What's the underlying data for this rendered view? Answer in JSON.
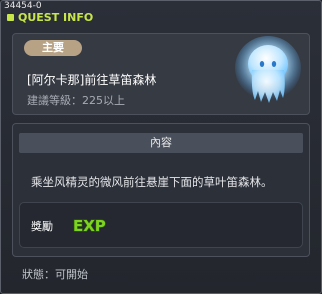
{
  "window": {
    "quest_id": "34454-0",
    "title": "QUEST INFO"
  },
  "summary": {
    "badge": "主要",
    "quest_name": "[阿尔卡那]前往草笛森林",
    "level_requirement": "建議等級：225以上",
    "npc_icon": "blue-ghost-spirit-icon"
  },
  "content": {
    "heading": "內容",
    "description": "乘坐风精灵的微风前往悬崖下面的草叶笛森林。"
  },
  "reward": {
    "label": "獎勵",
    "exp_icon": "exp-icon",
    "exp_text": "EXP"
  },
  "status": {
    "text": "狀態：可開始"
  },
  "colors": {
    "title_accent": "#c8e64a",
    "badge_bg": "#b8a285",
    "exp_green": "#7ed321"
  }
}
